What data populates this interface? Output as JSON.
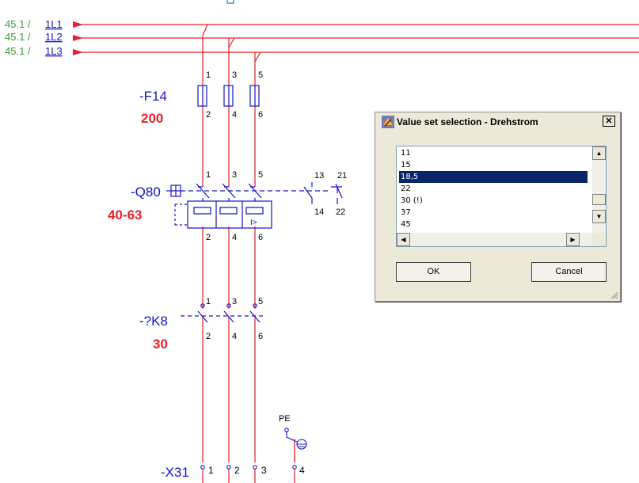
{
  "schematic": {
    "refs": [
      "45.1 /",
      "45.1 /",
      "45.1 /"
    ],
    "phases": [
      "1L1",
      "1L2",
      "1L3"
    ],
    "fuse": {
      "name": "-F14",
      "value": "200",
      "pins_top": [
        "1",
        "3",
        "5"
      ],
      "pins_bottom": [
        "2",
        "4",
        "6"
      ]
    },
    "breaker": {
      "name": "-Q80",
      "value": "40-63",
      "pins_top": [
        "1",
        "3",
        "5"
      ],
      "pins_bottom": [
        "2",
        "4",
        "6"
      ],
      "aux_top": [
        "13",
        "21"
      ],
      "aux_bottom": [
        "14",
        "22"
      ],
      "overcurrent_label": "I>"
    },
    "contactor": {
      "name": "-?K8",
      "value": "30",
      "pins_top": [
        "1",
        "3",
        "5"
      ],
      "pins_bottom": [
        "2",
        "4",
        "6"
      ]
    },
    "pe_label": "PE",
    "terminal": {
      "name": "-X31",
      "pins": [
        "1",
        "2",
        "3",
        "4"
      ]
    }
  },
  "dialog": {
    "title": "Value set selection - Drehstrom",
    "close_label": "✕",
    "items": [
      "11",
      "15",
      "18,5",
      "22",
      "30 (!)",
      "37",
      "45"
    ],
    "selected": "18,5",
    "ok_label": "OK",
    "cancel_label": "Cancel"
  },
  "colors": {
    "wire": "#e8202a",
    "symbol": "#1414c8",
    "value": "#e8202a",
    "ref": "#3c9a3c",
    "selection": "#0a246a"
  },
  "icons": {
    "dialog": "app-icon",
    "close": "close-icon",
    "scroll_up": "arrow-up-icon",
    "scroll_down": "arrow-down-icon",
    "scroll_left": "arrow-left-icon",
    "scroll_right": "arrow-right-icon",
    "grip": "resize-grip-icon",
    "ground": "ground-icon"
  }
}
